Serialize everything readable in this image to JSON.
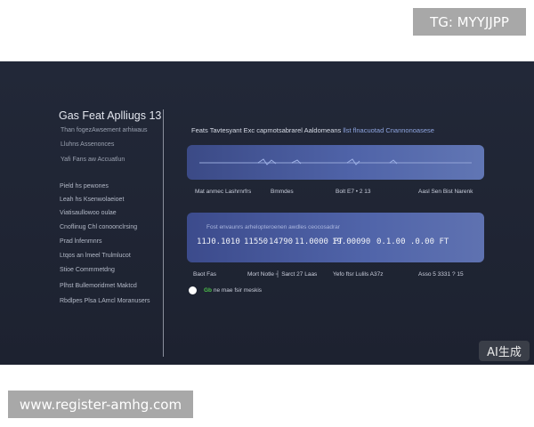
{
  "watermark_top": "TG: MYYJJPP",
  "watermark_bottom": "www.register-amhg.com",
  "ai_badge": "AI生成",
  "sidebar": {
    "title": "Gas Feat Aplliugs 13",
    "subtitles": [
      "Than fogezAwsement arhiwaus",
      "Lluhns Assenonces",
      "Yafi Fans aw Accuatlun"
    ],
    "items": [
      "Pield hs pewones",
      "Leah hs Ksenwolaeioet",
      "Viatisaullowoo oulae",
      "Cnoflinug Chl conoonclrsing",
      "Prad lnfenmnrs",
      "Ltqos an lmeel Trulmlucot",
      "Stioe Commmetdng",
      "Plhst Bullemoridmet Maktcd",
      "Rbdlpes Plsa LAmcl Moranusers"
    ]
  },
  "main": {
    "heading_text": "Feats Tavtesyant Exc  capmotsabrarel Aaldomeans",
    "heading_highlight": "llst flnacuotad Cnannonoasese",
    "wave_labels": [
      "Mat anmec Lashrnrfrs",
      "Bmmdes",
      "Bolt E7 • 2 13",
      "Aasl Sen  Bist  Narenk"
    ],
    "values_caption": "Fost envaunrs arhelopteroenen awdles ceocosadrar",
    "values": [
      "11J0.1010",
      "11550",
      "14790",
      "11.0000  FT",
      "19.00090",
      "0.1.00 .0.00  FT"
    ],
    "value_labels": [
      "Baot  Fas",
      "Mort Notle ┤  Sarct 27 Laas",
      "Yefo ftsr Lulils A37z",
      "Asso 5 3331 ? 15"
    ],
    "toggle_accent": "Gb",
    "toggle_label": "ne mae fsir meskis"
  },
  "colors": {
    "background": "#1f2433",
    "card_gradient_start": "#3b4a86",
    "card_gradient_end": "#6176b4",
    "accent_green": "#4cc04a"
  }
}
